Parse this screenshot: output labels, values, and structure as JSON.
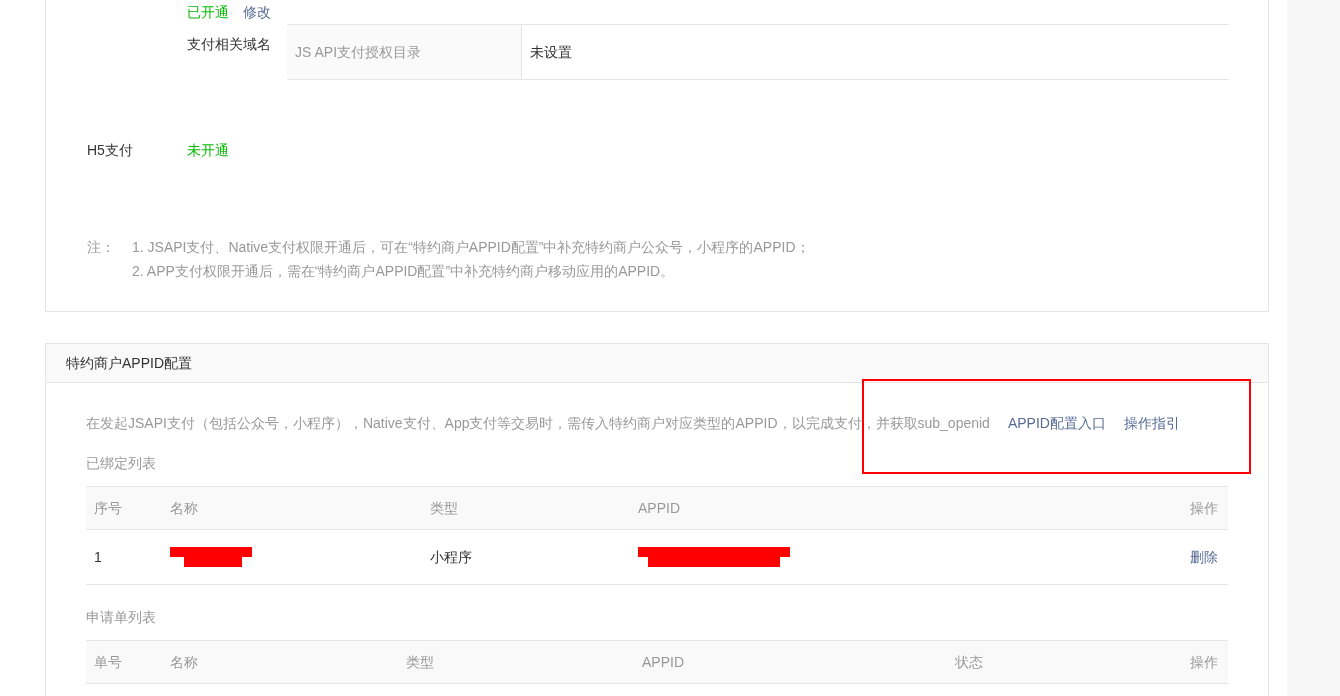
{
  "payment_section": {
    "top_row": {
      "status": "已开通",
      "action": "修改"
    },
    "domain": {
      "label": "支付相关域名",
      "rows": [
        {
          "key": "JS API支付授权目录",
          "value": "未设置"
        }
      ]
    },
    "h5": {
      "label": "H5支付",
      "status": "未开通"
    },
    "notes": {
      "prefix": "注：",
      "items": [
        "1. JSAPI支付、Native支付权限开通后，可在“特约商户APPID配置”中补充特约商户公众号，小程序的APPID；",
        "2. APP支付权限开通后，需在“特约商户APPID配置”中补充特约商户移动应用的APPID。"
      ]
    }
  },
  "appid_section": {
    "title": "特约商户APPID配置",
    "intro": {
      "text": "在发起JSAPI支付（包括公众号，小程序），Native支付、App支付等交易时，需传入特约商户对应类型的APPID，以完成支付，并获取sub_openid",
      "links": [
        "APPID配置入口",
        "操作指引"
      ],
      "highlighted": true
    },
    "bound_list": {
      "title": "已绑定列表",
      "columns": [
        "序号",
        "名称",
        "类型",
        "APPID",
        "操作"
      ],
      "rows": [
        {
          "index": "1",
          "name_redacted": true,
          "type": "小程序",
          "appid_redacted": true,
          "action": "删除"
        }
      ]
    },
    "application_list": {
      "title": "申请单列表",
      "columns": [
        "单号",
        "名称",
        "类型",
        "APPID",
        "状态",
        "操作"
      ]
    }
  }
}
